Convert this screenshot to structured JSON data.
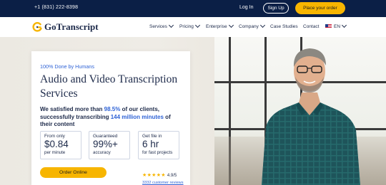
{
  "topbar": {
    "phone": "+1 (831) 222-8398",
    "login": "Log In",
    "signup": "Sign Up",
    "order": "Place your order"
  },
  "brand": {
    "name": "GoTranscript",
    "accent": "#f7b500",
    "navy": "#0b1f46",
    "link_blue": "#2f63d6"
  },
  "nav": {
    "items": [
      "Services",
      "Pricing",
      "Enterprise",
      "Company",
      "Case Studies",
      "Contact"
    ],
    "language": "EN"
  },
  "hero": {
    "tagline": "100% Done by Humans",
    "title": "Audio and Video Transcription Services",
    "desc_part1": "We satisfied more than ",
    "desc_hl1": "98.5%",
    "desc_part2": " of our clients, successfully transcribing ",
    "desc_hl2": "144 million minutes",
    "desc_part3": " of their content",
    "stats": [
      {
        "label": "From only",
        "value": "$0.84",
        "sub": "per minute"
      },
      {
        "label": "Guaranteed",
        "value": "99%+",
        "sub": "accuracy"
      },
      {
        "label": "Get file in",
        "value": "6 hr",
        "sub": "for fast projects"
      }
    ],
    "cta": "Order Online",
    "rating": {
      "stars": "★★★★★",
      "score": "4.9/5",
      "reviews": "3332 customer reviews"
    }
  }
}
